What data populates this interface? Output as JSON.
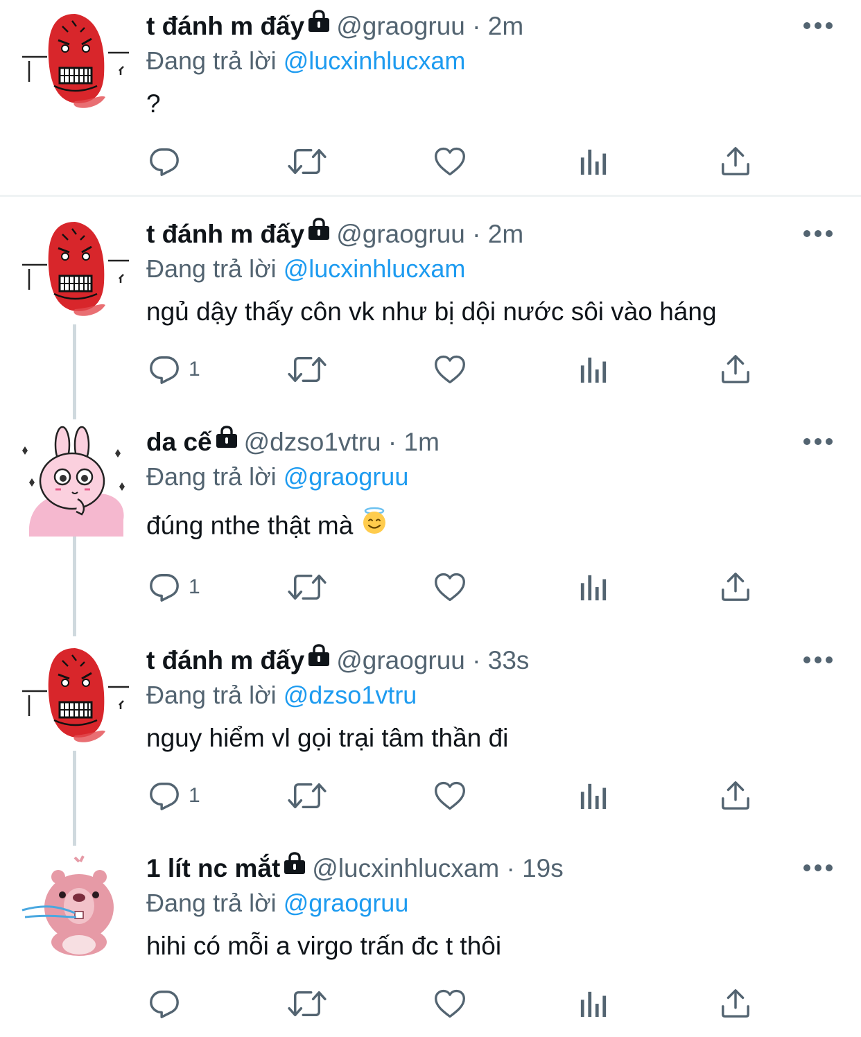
{
  "tweets": [
    {
      "display_name": "t đánh m đấy",
      "handle": "@graogruu",
      "separator": "·",
      "time": "2m",
      "replying_label": "Đang trả lời",
      "replying_to": "@lucxinhlucxam",
      "text": "?",
      "reply_count": "",
      "avatar_icon": "red-rage-face-avatar"
    },
    {
      "display_name": "t đánh m đấy",
      "handle": "@graogruu",
      "separator": "·",
      "time": "2m",
      "replying_label": "Đang trả lời",
      "replying_to": "@lucxinhlucxam",
      "text": "ngủ dậy thấy côn vk như bị dội nước sôi vào háng",
      "reply_count": "1",
      "avatar_icon": "red-rage-face-avatar"
    },
    {
      "display_name": "da cế",
      "handle": "@dzso1vtru",
      "separator": "·",
      "time": "1m",
      "replying_label": "Đang trả lời",
      "replying_to": "@graogruu",
      "text": "đúng nthe thật mà",
      "emoji": "smiling-face-with-halo",
      "reply_count": "1",
      "avatar_icon": "pink-bunny-avatar"
    },
    {
      "display_name": "t đánh m đấy",
      "handle": "@graogruu",
      "separator": "·",
      "time": "33s",
      "replying_label": "Đang trả lời",
      "replying_to": "@dzso1vtru",
      "text": "nguy hiểm vl gọi trại tâm thần đi",
      "reply_count": "1",
      "avatar_icon": "red-rage-face-avatar"
    },
    {
      "display_name": "1 lít nc mắt",
      "handle": "@lucxinhlucxam",
      "separator": "·",
      "time": "19s",
      "replying_label": "Đang trả lời",
      "replying_to": "@graogruu",
      "text": "hihi có mỗi a virgo trấn đc t thôi",
      "reply_count": "",
      "avatar_icon": "pink-beaver-avatar"
    }
  ],
  "icons": {
    "reply": "reply-icon",
    "retweet": "retweet-icon",
    "like": "heart-icon",
    "views": "views-icon",
    "share": "share-icon",
    "more": "more-icon",
    "lock": "lock-icon"
  },
  "colors": {
    "text": "#0f1419",
    "secondary": "#536471",
    "mention": "#1d9bf0",
    "thread_line": "#cfd9de",
    "divider": "#eff3f4"
  }
}
